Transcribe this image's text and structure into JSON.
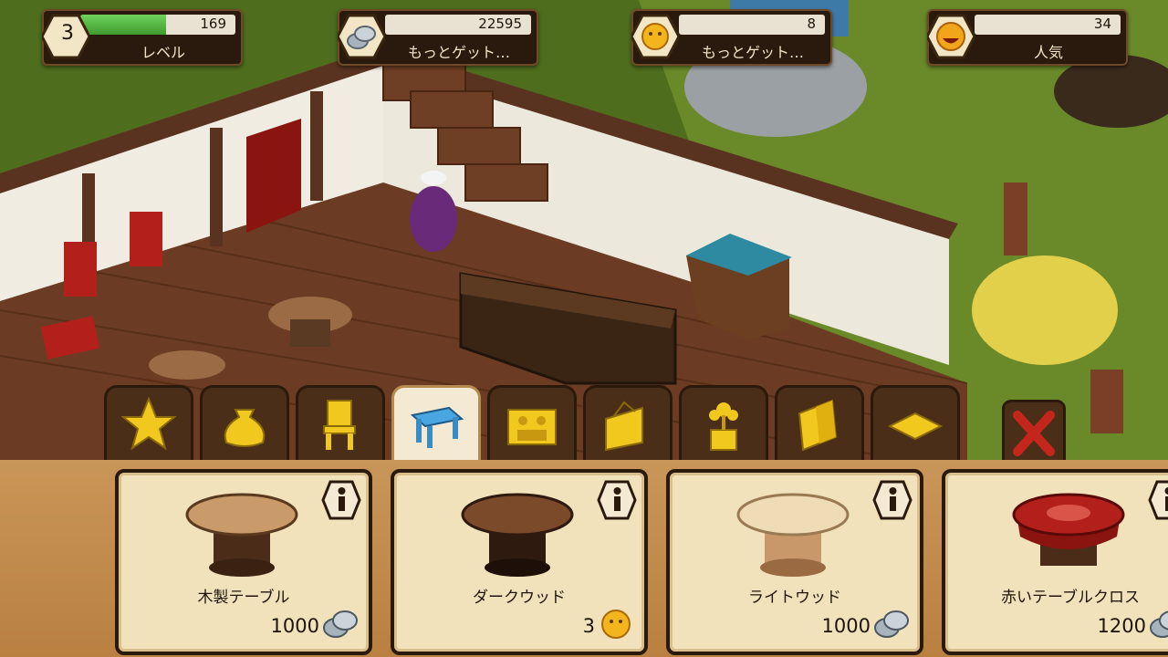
{
  "hud": {
    "level": {
      "number": "3",
      "xp": "169",
      "label": "レベル",
      "progress": 0.55
    },
    "silver": {
      "amount": "22595",
      "label": "もっとゲット…"
    },
    "gold": {
      "amount": "8",
      "label": "もっとゲット…"
    },
    "popularity": {
      "amount": "34",
      "label": "人気"
    }
  },
  "tabs": [
    {
      "icon": "star-icon",
      "active": false
    },
    {
      "icon": "money-bag-icon",
      "active": false
    },
    {
      "icon": "chair-icon",
      "active": false
    },
    {
      "icon": "table-icon",
      "active": true
    },
    {
      "icon": "stove-icon",
      "active": false
    },
    {
      "icon": "wall-decor-icon",
      "active": false
    },
    {
      "icon": "plant-icon",
      "active": false
    },
    {
      "icon": "wallpaper-icon",
      "active": false
    },
    {
      "icon": "floor-tile-icon",
      "active": false
    }
  ],
  "close_icon": "close-x-icon",
  "items": [
    {
      "name": "木製テーブル",
      "price": "1000",
      "currency": "silver",
      "top_color": "#c99a6a"
    },
    {
      "name": "ダークウッド",
      "price": "3",
      "currency": "gold",
      "top_color": "#7a4a2a"
    },
    {
      "name": "ライトウッド",
      "price": "1000",
      "currency": "silver",
      "top_color": "#efdcb4"
    },
    {
      "name": "赤いテーブルクロス",
      "price": "1200",
      "currency": "silver",
      "top_color": "#b3201c"
    }
  ],
  "colors": {
    "accent_green": "#4caf3a",
    "panel_brown": "#b98040",
    "tab_dark": "#4a2e17"
  }
}
